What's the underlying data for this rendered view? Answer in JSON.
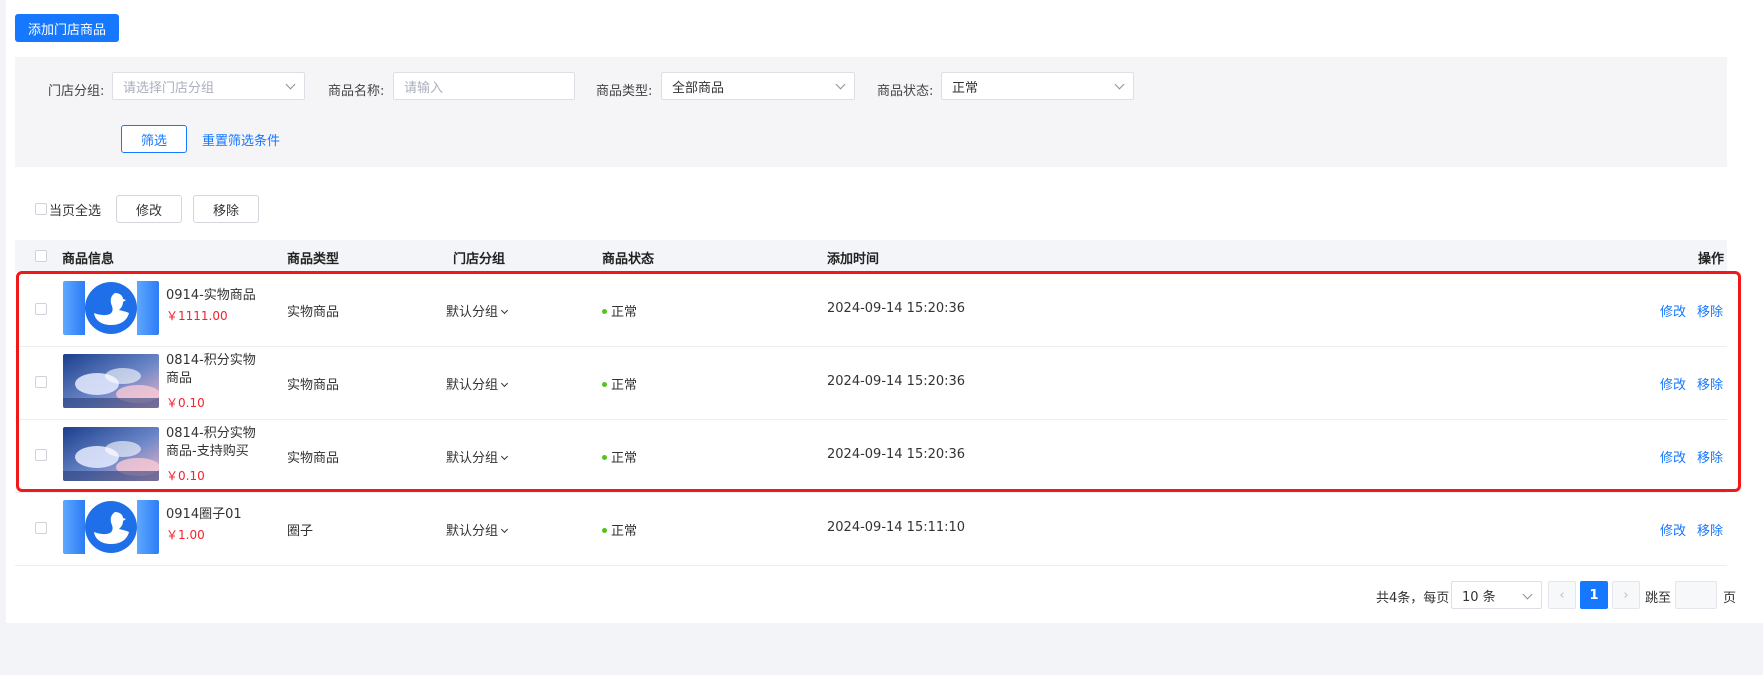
{
  "toolbar": {
    "add_button": "添加门店商品"
  },
  "filters": {
    "group_label": "门店分组:",
    "group_placeholder": "请选择门店分组",
    "name_label": "商品名称:",
    "name_placeholder": "请输入",
    "type_label": "商品类型:",
    "type_value": "全部商品",
    "status_label": "商品状态:",
    "status_value": "正常",
    "filter_button": "筛选",
    "reset_link": "重置筛选条件"
  },
  "bulk": {
    "select_all": "当页全选",
    "edit_button": "修改",
    "remove_button": "移除"
  },
  "table": {
    "headers": {
      "info": "商品信息",
      "type": "商品类型",
      "group": "门店分组",
      "status": "商品状态",
      "time": "添加时间",
      "ops": "操作"
    },
    "rows": [
      {
        "name": "0914-实物商品",
        "price": "￥1111.00",
        "type": "实物商品",
        "group": "默认分组",
        "status": "正常",
        "time": "2024-09-14 15:20:36",
        "edit": "修改",
        "remove": "移除",
        "thumb": "duck-logo-icon"
      },
      {
        "name": "0814-积分实物商品",
        "price": "￥0.10",
        "type": "实物商品",
        "group": "默认分组",
        "status": "正常",
        "time": "2024-09-14 15:20:36",
        "edit": "修改",
        "remove": "移除",
        "thumb": "sky-image"
      },
      {
        "name": "0814-积分实物商品-支持购买",
        "price": "￥0.10",
        "type": "实物商品",
        "group": "默认分组",
        "status": "正常",
        "time": "2024-09-14 15:20:36",
        "edit": "修改",
        "remove": "移除",
        "thumb": "sky-image"
      },
      {
        "name": "0914圈子01",
        "price": "￥1.00",
        "type": "圈子",
        "group": "默认分组",
        "status": "正常",
        "time": "2024-09-14 15:11:10",
        "edit": "修改",
        "remove": "移除",
        "thumb": "duck-logo-icon"
      }
    ]
  },
  "pagination": {
    "total_text": "共4条，每页",
    "page_size": "10 条",
    "current_page": "1",
    "goto_label": "跳至",
    "page_suffix": "页"
  },
  "colors": {
    "primary": "#1677ff",
    "price": "#f5222d",
    "status_dot": "#52c41a",
    "highlight": "#f01818"
  }
}
